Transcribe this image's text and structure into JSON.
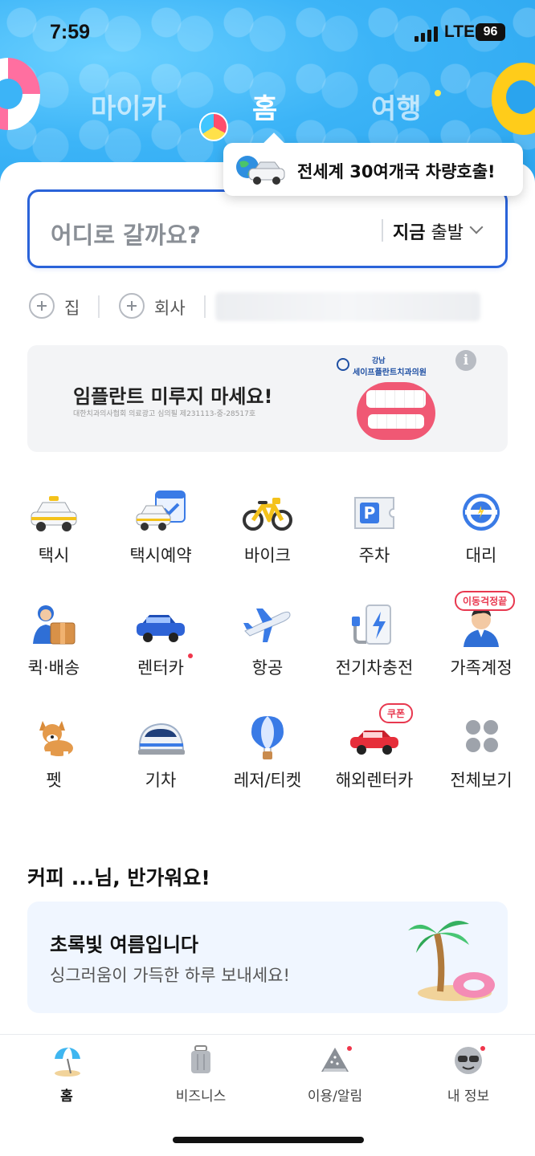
{
  "status_bar": {
    "time": "7:59",
    "network": "LTE",
    "battery": "96"
  },
  "top_tabs": [
    {
      "label": "마이카",
      "active": false
    },
    {
      "label": "홈",
      "active": true
    },
    {
      "label": "여행",
      "active": false
    }
  ],
  "tooltip": {
    "text": "전세계 30여개국 차량호출!"
  },
  "search": {
    "placeholder": "어디로 갈까요?",
    "depart_bold": "지금",
    "depart_rest": " 출발"
  },
  "quick_places": [
    {
      "label": "집"
    },
    {
      "label": "회사"
    }
  ],
  "ad": {
    "title": "임플란트 미루지 마세요!",
    "subtitle": "대한치과의사협회 의료광고 심의필 제231113-중-28517호",
    "brand_region": "강남",
    "brand": "세이프플란트치과의원",
    "info_glyph": "i"
  },
  "services": [
    {
      "label": "택시",
      "icon": "taxi-icon"
    },
    {
      "label": "택시예약",
      "icon": "taxi-reservation-icon"
    },
    {
      "label": "바이크",
      "icon": "bike-icon"
    },
    {
      "label": "주차",
      "icon": "parking-icon"
    },
    {
      "label": "대리",
      "icon": "designated-driver-icon"
    },
    {
      "label": "퀵·배송",
      "icon": "quick-delivery-icon"
    },
    {
      "label": "렌터카",
      "icon": "rental-car-icon"
    },
    {
      "label": "항공",
      "icon": "airplane-icon"
    },
    {
      "label": "전기차충전",
      "icon": "ev-charging-icon"
    },
    {
      "label": "가족계정",
      "icon": "family-account-icon"
    },
    {
      "label": "펫",
      "icon": "pet-icon"
    },
    {
      "label": "기차",
      "icon": "train-icon"
    },
    {
      "label": "레저/티켓",
      "icon": "leisure-ticket-icon"
    },
    {
      "label": "해외렌터카",
      "icon": "overseas-rental-icon"
    },
    {
      "label": "전체보기",
      "icon": "view-all-icon"
    }
  ],
  "badges": {
    "family_account": "이동걱정끝",
    "overseas_rental": "쿠폰"
  },
  "greeting": "커피 ...님, 반가워요!",
  "promo": {
    "title": "초록빛 여름입니다",
    "subtitle": "싱그러움이 가득한 하루 보내세요!"
  },
  "bottom_nav": [
    {
      "label": "홈",
      "active": true
    },
    {
      "label": "비즈니스",
      "active": false
    },
    {
      "label": "이용/알림",
      "active": false
    },
    {
      "label": "내 정보",
      "active": false
    }
  ],
  "colors": {
    "accent": "#2a63d9",
    "header_blue": "#3cb4f7",
    "notification_red": "#f0364b"
  }
}
